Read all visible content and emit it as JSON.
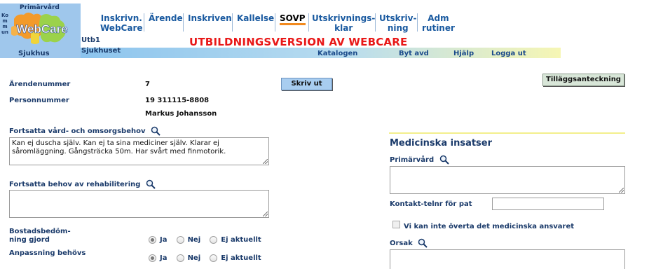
{
  "header": {
    "brand_top": "Primärvård",
    "brand_side": "Kommun",
    "logo_text": "WebCare",
    "unit": "Utb1",
    "hospital_left": "Sjukhus",
    "hospital": "Sjukhuset",
    "banner": "UTBILDNINGSVERSION AV WEBCARE",
    "nav": [
      {
        "line1": "Inskrivn.",
        "line2": "WebCare"
      },
      {
        "line1": "Ärende",
        "line2": ""
      },
      {
        "line1": "Inskriven",
        "line2": ""
      },
      {
        "line1": "Kallelse",
        "line2": ""
      },
      {
        "line1": "SOVP",
        "line2": ""
      },
      {
        "line1": "Utskrivnings-",
        "line2": "klar"
      },
      {
        "line1": "Utskriv-",
        "line2": "ning"
      },
      {
        "line1": "Adm",
        "line2": "rutiner"
      }
    ],
    "sublinks": [
      "Katalogen",
      "Byt avd",
      "Hjälp",
      "Logga ut"
    ]
  },
  "form": {
    "arende_label": "Ärendenummer",
    "arende_value": "7",
    "person_label": "Personnummer",
    "person_value": "19 311115-8808",
    "name_value": "Markus Johansson",
    "print_button": "Skriv ut",
    "addendum_button": "Tilläggsanteckning",
    "care_label": "Fortsatta vård- och omsorgsbehov",
    "care_text": "Kan ej duscha själv. Kan ej ta sina mediciner själv. Klarar ej såromläggning. Gångsträcka 50m. Har svårt med finmotorik.",
    "rehab_label": "Fortsatta behov av rehabilitering",
    "rehab_text": "",
    "housing_label": "Bostadsbedöm-ning gjord",
    "adapt_label": "Anpassning behövs",
    "radio_options": [
      "Ja",
      "Nej",
      "Ej aktuellt"
    ],
    "housing_selected": "Ja",
    "adapt_selected": "Ja"
  },
  "medical": {
    "heading": "Medicinska insatser",
    "primary_label": "Primärvård",
    "primary_text": "",
    "contact_label": "Kontakt-telnr för pat",
    "contact_value": "",
    "cannot_take_label": "Vi kan inte överta det medicinska ansvaret",
    "cannot_take_checked": false,
    "reason_label": "Orsak",
    "reason_text": ""
  },
  "colors": {
    "nav_text": "#1a5aa0",
    "banner": "#e81818",
    "active_underline": "#f28a1e",
    "header_bar": "#9fc7ec"
  }
}
